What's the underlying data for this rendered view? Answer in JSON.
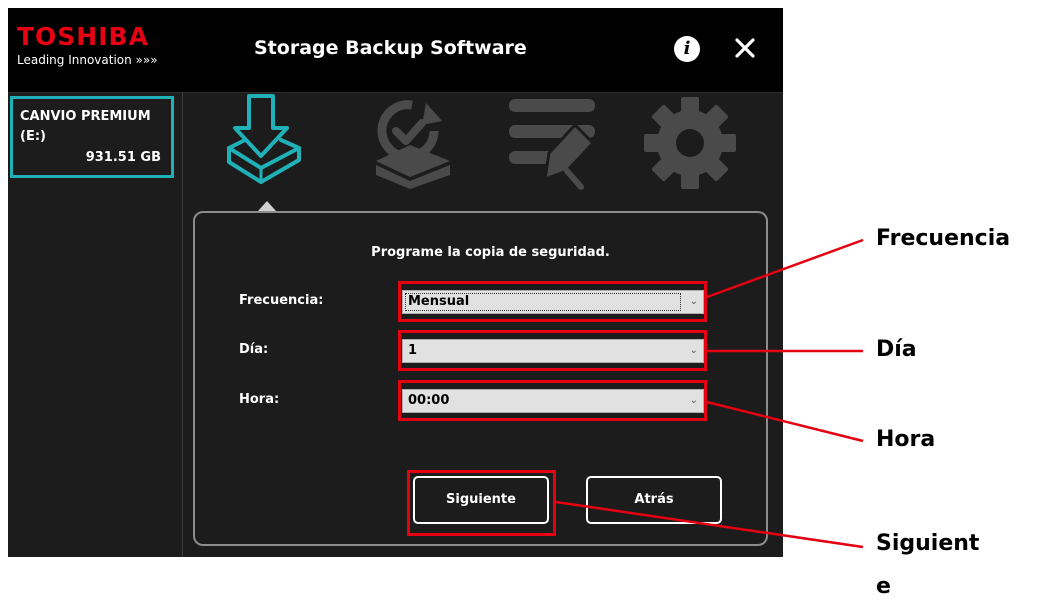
{
  "brand": {
    "name": "TOSHIBA",
    "tagline": "Leading Innovation »»»"
  },
  "titlebar": {
    "title": "Storage Backup Software",
    "info_label": "i",
    "close_icon": "close-icon"
  },
  "sidebar": {
    "drive": {
      "name": "CANVIO PREMIUM",
      "letter": "(E:)",
      "size": "931.51 GB"
    }
  },
  "tabs": [
    {
      "id": "backup",
      "icon": "backup-download-icon",
      "active": true
    },
    {
      "id": "restore",
      "icon": "restore-icon",
      "active": false
    },
    {
      "id": "tools",
      "icon": "tools-list-icon",
      "active": false
    },
    {
      "id": "settings",
      "icon": "gear-icon",
      "active": false
    }
  ],
  "form": {
    "heading": "Programe la copia de seguridad.",
    "frequency_label": "Frecuencia:",
    "frequency_value": "Mensual",
    "day_label": "Día:",
    "day_value": "1",
    "time_label": "Hora:",
    "time_value": "00:00",
    "next_button": "Siguiente",
    "back_button": "Atrás"
  },
  "callouts": {
    "frequency": "Frecuencia",
    "day": "Día",
    "time": "Hora",
    "next_line1": "Siguient",
    "next_line2": "e"
  },
  "colors": {
    "accent": "#1fb0b8",
    "brand": "#e50012",
    "highlight": "#e50012"
  }
}
